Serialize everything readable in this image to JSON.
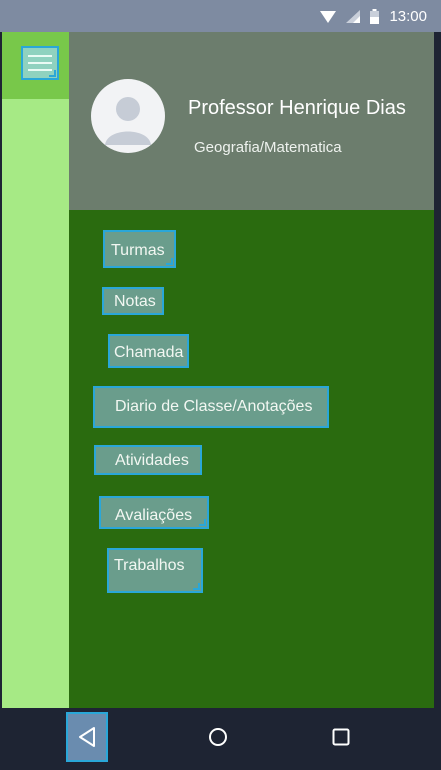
{
  "status_bar": {
    "time": "13:00"
  },
  "drawer": {
    "professor_name": "Professor Henrique Dias",
    "subjects": "Geografia/Matematica"
  },
  "menu": {
    "items": [
      {
        "label": "Turmas"
      },
      {
        "label": "Notas"
      },
      {
        "label": "Chamada"
      },
      {
        "label": "Diario de Classe/Anotações"
      },
      {
        "label": "Atividades"
      },
      {
        "label": "Avaliações"
      },
      {
        "label": "Trabalhos"
      }
    ]
  },
  "colors": {
    "drawer_background": "#2a6b0f",
    "header_background": "#6c7d6d",
    "left_strip": "#a6ea85",
    "item_highlight_border": "#2aa7d8"
  },
  "icons": {
    "status": [
      "wifi-icon",
      "signal-icon",
      "battery-icon"
    ],
    "navigation": [
      "back-icon",
      "home-icon",
      "recent-apps-icon"
    ],
    "toolbar": "hamburger-menu-icon",
    "profile": "avatar-icon"
  }
}
